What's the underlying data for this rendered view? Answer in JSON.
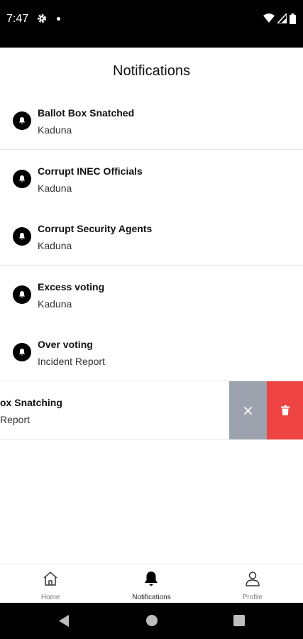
{
  "status_bar": {
    "time": "7:47",
    "icons": [
      "gear-icon",
      "dot-icon",
      "wifi-icon",
      "signal-icon",
      "battery-icon"
    ]
  },
  "header": {
    "title": "Notifications"
  },
  "notifications": [
    {
      "title": "Ballot Box Snatched",
      "subtitle": "Kaduna",
      "icon": "bell-icon"
    },
    {
      "title": "Corrupt INEC Officials",
      "subtitle": "Kaduna",
      "icon": "bell-icon"
    },
    {
      "title": "Corrupt Security Agents",
      "subtitle": "Kaduna",
      "icon": "bell-icon"
    },
    {
      "title": "Excess voting",
      "subtitle": "Kaduna",
      "icon": "bell-icon"
    },
    {
      "title": "Over voting",
      "subtitle": "Incident Report",
      "icon": "bell-icon"
    }
  ],
  "swiped_notification": {
    "title": "ox Snatching",
    "subtitle": "Report",
    "actions": {
      "close": "close-icon",
      "delete": "trash-icon"
    },
    "colors": {
      "close_bg": "#9ca3af",
      "delete_bg": "#ef4444"
    }
  },
  "tab_bar": {
    "tabs": [
      {
        "label": "Home",
        "icon": "home-icon",
        "active": false
      },
      {
        "label": "Notifications",
        "icon": "bell-icon",
        "active": true
      },
      {
        "label": "Profile",
        "icon": "user-icon",
        "active": false
      }
    ]
  },
  "nav_bar": {
    "buttons": [
      "back-icon",
      "home-circle-icon",
      "recents-icon"
    ]
  }
}
